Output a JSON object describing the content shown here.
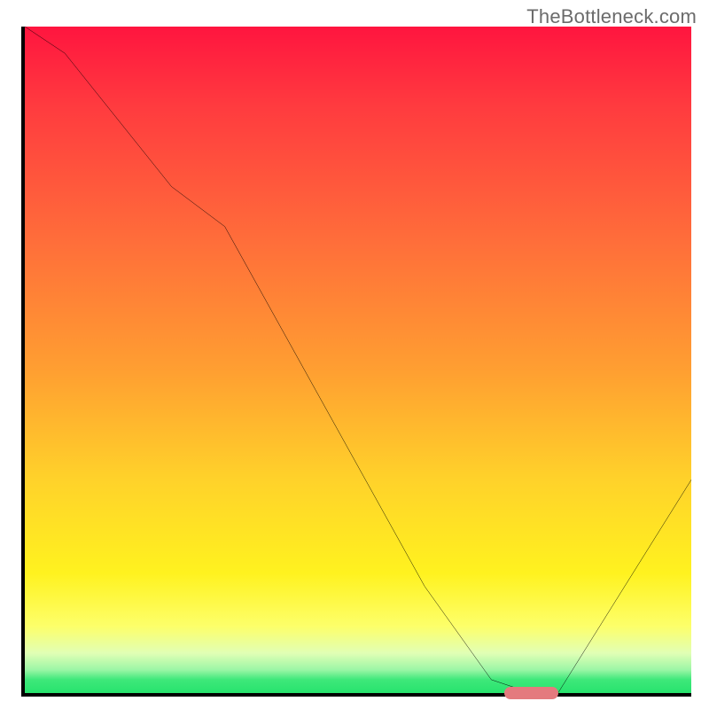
{
  "watermark": "TheBottleneck.com",
  "chart_data": {
    "type": "line",
    "title": "",
    "xlabel": "",
    "ylabel": "",
    "xlim": [
      0,
      100
    ],
    "ylim": [
      0,
      100
    ],
    "series": [
      {
        "name": "curve",
        "x": [
          0,
          6,
          22,
          30,
          60,
          70,
          76,
          80,
          100
        ],
        "y": [
          100,
          96,
          76,
          70,
          16,
          2,
          0,
          0,
          32
        ]
      }
    ],
    "annotations": [
      {
        "name": "sweet-spot-marker",
        "x_start": 72,
        "x_end": 80,
        "y": 0,
        "color": "#e47a7e"
      }
    ],
    "gradient_stops": [
      {
        "pos": 0.0,
        "color": "#ff153f"
      },
      {
        "pos": 0.12,
        "color": "#ff3b3f"
      },
      {
        "pos": 0.32,
        "color": "#ff6d3a"
      },
      {
        "pos": 0.52,
        "color": "#ffa031"
      },
      {
        "pos": 0.68,
        "color": "#ffd22a"
      },
      {
        "pos": 0.82,
        "color": "#fff21f"
      },
      {
        "pos": 0.9,
        "color": "#fdff6a"
      },
      {
        "pos": 0.94,
        "color": "#e1ffb5"
      },
      {
        "pos": 0.965,
        "color": "#9cf6a6"
      },
      {
        "pos": 0.98,
        "color": "#3ee87a"
      },
      {
        "pos": 1.0,
        "color": "#27e36d"
      }
    ]
  }
}
